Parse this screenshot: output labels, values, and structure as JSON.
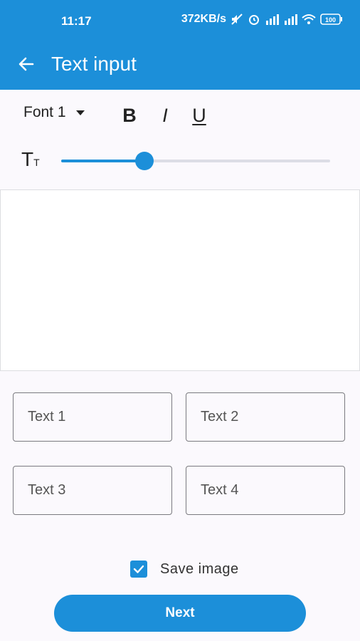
{
  "status_bar": {
    "time": "11:17",
    "network_speed": "372KB/s",
    "battery": "100",
    "icons": [
      "mute-icon",
      "alarm-icon",
      "signal-icon",
      "signal-icon",
      "wifi-icon",
      "battery-icon"
    ]
  },
  "app_bar": {
    "title": "Text input",
    "back_icon": "arrow-left-icon",
    "color": "#1c8fd9"
  },
  "toolbar": {
    "font_label": "Font 1",
    "bold_label": "B",
    "italic_label": "I",
    "underline_label": "U"
  },
  "size_slider": {
    "icon_label": "T",
    "icon_small": "T",
    "value_fraction": 0.31
  },
  "fields": {
    "text1": {
      "placeholder": "Text 1"
    },
    "text2": {
      "placeholder": "Text 2"
    },
    "text3": {
      "placeholder": "Text 3"
    },
    "text4": {
      "placeholder": "Text 4"
    }
  },
  "save": {
    "label": "Save image",
    "checked": true
  },
  "next_button": {
    "label": "Next"
  }
}
